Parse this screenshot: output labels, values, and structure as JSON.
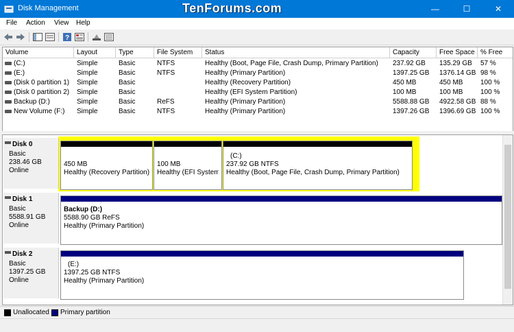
{
  "window": {
    "title": "Disk Management",
    "watermark": "TenForums.com",
    "minimize": "—",
    "maximize": "☐",
    "close": "✕"
  },
  "menu": [
    "File",
    "Action",
    "View",
    "Help"
  ],
  "toolbar_icons": [
    "back-icon",
    "forward-icon",
    "console-tree-icon",
    "help-icon",
    "properties-icon",
    "disk-icon",
    "list-icon"
  ],
  "volume_table": {
    "columns": [
      "Volume",
      "Layout",
      "Type",
      "File System",
      "Status",
      "Capacity",
      "Free Space",
      "% Free"
    ],
    "rows": [
      [
        "(C:)",
        "Simple",
        "Basic",
        "NTFS",
        "Healthy (Boot, Page File, Crash Dump, Primary Partition)",
        "237.92 GB",
        "135.29 GB",
        "57 %"
      ],
      [
        "(E:)",
        "Simple",
        "Basic",
        "NTFS",
        "Healthy (Primary Partition)",
        "1397.25 GB",
        "1376.14 GB",
        "98 %"
      ],
      [
        "(Disk 0 partition 1)",
        "Simple",
        "Basic",
        "",
        "Healthy (Recovery Partition)",
        "450 MB",
        "450 MB",
        "100 %"
      ],
      [
        "(Disk 0 partition 2)",
        "Simple",
        "Basic",
        "",
        "Healthy (EFI System Partition)",
        "100 MB",
        "100 MB",
        "100 %"
      ],
      [
        "Backup (D:)",
        "Simple",
        "Basic",
        "ReFS",
        "Healthy (Primary Partition)",
        "5588.88 GB",
        "4922.58 GB",
        "88 %"
      ],
      [
        "New Volume (F:)",
        "Simple",
        "Basic",
        "NTFS",
        "Healthy (Primary Partition)",
        "1397.26 GB",
        "1396.69 GB",
        "100 %"
      ]
    ]
  },
  "disks": [
    {
      "name": "Disk 0",
      "type": "Basic",
      "size": "238.46 GB",
      "state": "Online",
      "partitions": [
        {
          "title": "",
          "size": "450 MB",
          "status": "Healthy (Recovery Partition)"
        },
        {
          "title": "",
          "size": "100 MB",
          "status": "Healthy (EFI System P"
        },
        {
          "title": "(C:)",
          "size": "237.92 GB NTFS",
          "status": "Healthy (Boot, Page File, Crash Dump, Primary Partition)"
        }
      ]
    },
    {
      "name": "Disk 1",
      "type": "Basic",
      "size": "5588.91 GB",
      "state": "Online",
      "partitions": [
        {
          "title": "Backup  (D:)",
          "size": "5588.90 GB ReFS",
          "status": "Healthy (Primary Partition)"
        }
      ]
    },
    {
      "name": "Disk 2",
      "type": "Basic",
      "size": "1397.25 GB",
      "state": "Online",
      "partitions": [
        {
          "title": "(E:)",
          "size": "1397.25 GB NTFS",
          "status": "Healthy (Primary Partition)"
        }
      ]
    }
  ],
  "legend": {
    "unallocated": "Unallocated",
    "primary": "Primary partition"
  },
  "colors": {
    "titlebar": "#0078d7",
    "primary_bar": "#00007f",
    "unallocated": "#000000",
    "highlight": "#ffff00"
  }
}
